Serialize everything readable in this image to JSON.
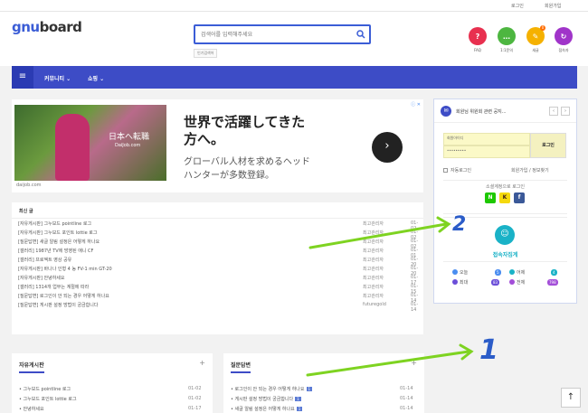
{
  "topbar": {
    "login": "로그인",
    "register": "회원가입"
  },
  "header": {
    "logo_a": "gnu",
    "logo_b": "board",
    "search_placeholder": "검색어를 입력해주세요",
    "popular": "인기검색어",
    "quick": [
      {
        "label": "FAQ",
        "icon": "?",
        "color": "#e8304f"
      },
      {
        "label": "1:1문의",
        "icon": "…",
        "color": "#4db640"
      },
      {
        "label": "새글",
        "icon": "✎",
        "color": "#f5b100"
      },
      {
        "label": "접속자",
        "icon": "↻",
        "color": "#a034c9"
      }
    ],
    "badge": "0"
  },
  "nav": {
    "menu1": "커뮤니티 ⌄",
    "menu2": "쇼핑 ⌄"
  },
  "ad": {
    "photo_title": "日本へ転職",
    "photo_sub": "DaiJob.com",
    "headline1": "世界で活躍してきた",
    "headline2": "方へ。",
    "body1": "グローバル人材を求めるヘッド",
    "body2": "ハンターが多数登録。",
    "domain": "daijob.com",
    "adchoice": "ⓘ ✕"
  },
  "latest": {
    "title": "최신 글",
    "rows": [
      {
        "t": "[자유게시판] 그누보드 pointline 로그",
        "a": "최고관리자",
        "d": "01-02"
      },
      {
        "t": "[자유게시판] 그누보드 포인트 lottie 로그",
        "a": "최고관리자",
        "d": "01-02"
      },
      {
        "t": "[질문답변] 새글 알림 설정은 어떻게 하나요",
        "a": "최고관리자",
        "d": "01-02"
      },
      {
        "t": "[갤러리] 1987년 TV에 방영된 애니 CF",
        "a": "최고관리자",
        "d": "01-01"
      },
      {
        "t": "[갤러리] 프로젝트 영상 공유",
        "a": "최고관리자",
        "d": "01-20"
      },
      {
        "t": "[자유게시판] 바나나 인형 4 농 FV-1 min GT-20",
        "a": "최고관리자",
        "d": "01-20"
      },
      {
        "t": "[자유게시판] 안녕하세요",
        "a": "최고관리자",
        "d": "01-17"
      },
      {
        "t": "[갤러리] 1314개 업무는 계절에 따라",
        "a": "최고관리자",
        "d": "01-15"
      },
      {
        "t": "[질문답변] 로그인이 안 되는 경우 어떻게 하나요",
        "a": "최고관리자",
        "d": "01-14"
      },
      {
        "t": "[질문답변] 게시판 설정 방법이 궁금합니다",
        "a": "futuregold",
        "d": "01-14"
      }
    ]
  },
  "side": {
    "notice": "회원님 위원회 관련 공지...",
    "prev": "‹",
    "next": "›",
    "id_label": "회원아이디",
    "pw_value": "•••••••••",
    "login_btn": "로그인",
    "auto": "자동로그인",
    "join": "회원가입 / 정보찾기",
    "social_title": "소셜계정으로 로그인",
    "social": [
      {
        "label": "N",
        "color": "#1ec800"
      },
      {
        "label": "K",
        "color": "#f5d90d"
      },
      {
        "label": "f",
        "color": "#3b5998"
      }
    ],
    "conn_title": "접속자집계",
    "stats": [
      {
        "k": "오늘",
        "v": "5",
        "c": "#4a8df0"
      },
      {
        "k": "어제",
        "v": "4",
        "c": "#1ab2c7"
      },
      {
        "k": "최대",
        "v": "83",
        "c": "#6b4ed8"
      },
      {
        "k": "전체",
        "v": "798",
        "c": "#a34ed8"
      }
    ]
  },
  "cards": {
    "free_title": "자유게시판",
    "qa_title": "질문답변",
    "plus": "+",
    "free_rows": [
      {
        "t": "그누보드 pointline 로그",
        "d": "01-02"
      },
      {
        "t": "그누보드 포인트 lottie 로그",
        "d": "01-02"
      },
      {
        "t": "안녕하세요",
        "d": "01-17"
      }
    ],
    "qa_rows": [
      {
        "t": "로그인이 안 되는 경우 어떻게 하나요",
        "tag": "1",
        "d": "01-14"
      },
      {
        "t": "게시판 설정 방법이 궁금합니다",
        "tag": "1",
        "d": "01-14"
      },
      {
        "t": "새글 알림 설정은 어떻게 하나요",
        "tag": "1",
        "d": "01-14"
      }
    ]
  },
  "annotations": {
    "one": "1",
    "two": "2"
  },
  "up_btn": "↑"
}
